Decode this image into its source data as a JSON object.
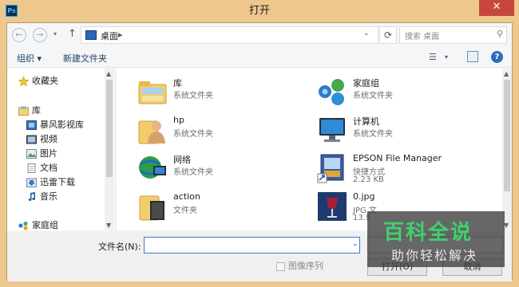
{
  "window": {
    "title": "打开",
    "app_icon_text": "Ps",
    "close_symbol": "✕"
  },
  "navigation": {
    "back_symbol": "←",
    "forward_symbol": "→",
    "dropdown_symbol": "▾",
    "up_symbol": "↑",
    "address": {
      "current": "桌面",
      "chevron": "▸",
      "dropdown": "⌄"
    },
    "refresh_symbol": "⟳",
    "search": {
      "placeholder": "搜索 桌面",
      "icon_symbol": "⚲"
    }
  },
  "toolbar": {
    "organize_label": "组织 ▾",
    "new_folder_label": "新建文件夹",
    "view_symbol": "☰",
    "view_dropdown_symbol": "▾",
    "help_symbol": "?"
  },
  "sidebar": {
    "items": [
      {
        "label": "收藏夹",
        "icon": "star-icon"
      },
      {
        "label": "库",
        "icon": "library-icon"
      },
      {
        "label": "暴风影视库",
        "icon": "video-library-icon"
      },
      {
        "label": "视频",
        "icon": "video-icon"
      },
      {
        "label": "图片",
        "icon": "picture-icon"
      },
      {
        "label": "文档",
        "icon": "document-icon"
      },
      {
        "label": "迅雷下载",
        "icon": "download-icon"
      },
      {
        "label": "音乐",
        "icon": "music-icon"
      },
      {
        "label": "家庭组",
        "icon": "homegroup-icon"
      }
    ]
  },
  "files": [
    {
      "name": "库",
      "type": "系统文件夹",
      "size": "",
      "icon": "library-folder-icon"
    },
    {
      "name": "家庭组",
      "type": "系统文件夹",
      "size": "",
      "icon": "homegroup-icon"
    },
    {
      "name": "hp",
      "type": "系统文件夹",
      "size": "",
      "icon": "user-folder-icon"
    },
    {
      "name": "计算机",
      "type": "系统文件夹",
      "size": "",
      "icon": "computer-icon"
    },
    {
      "name": "网络",
      "type": "系统文件夹",
      "size": "",
      "icon": "network-icon"
    },
    {
      "name": "EPSON File Manager",
      "type": "快捷方式",
      "size": "2.23 KB",
      "icon": "shortcut-icon"
    },
    {
      "name": "action",
      "type": "文件夹",
      "size": "",
      "icon": "folder-icon"
    },
    {
      "name": "0.jpg",
      "type": "JPG 文",
      "size": "13.9",
      "icon": "image-file-icon"
    }
  ],
  "bottom": {
    "filename_label": "文件名(N):",
    "filename_value": "",
    "filename_dropdown": "⌄",
    "image_sequence_label": "图像序列",
    "open_label": "打开(O)",
    "cancel_label": "取消"
  },
  "watermark": {
    "title": "百科全说",
    "subtitle": "助你轻松解决"
  },
  "colors": {
    "frame": "#eec78d",
    "close": "#c7463d",
    "accent": "#3a7bd5",
    "watermark_green": "#3fd16d"
  }
}
